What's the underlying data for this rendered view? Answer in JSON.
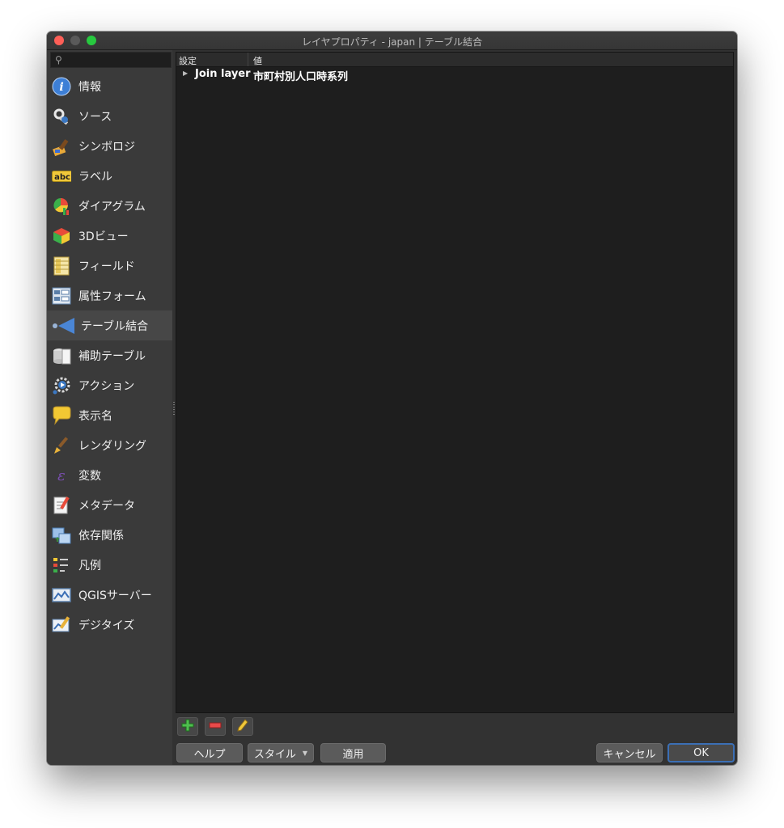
{
  "window": {
    "title": "レイヤプロパティ - japan | テーブル結合"
  },
  "search": {
    "value": "",
    "placeholder": ""
  },
  "sidebar": {
    "items": [
      {
        "label": "情報",
        "icon": "info-icon"
      },
      {
        "label": "ソース",
        "icon": "source-wrench-icon"
      },
      {
        "label": "シンボロジ",
        "icon": "paintbrush-icon"
      },
      {
        "label": "ラベル",
        "icon": "abc-label-icon"
      },
      {
        "label": "ダイアグラム",
        "icon": "diagram-icon"
      },
      {
        "label": "3Dビュー",
        "icon": "cube-3d-icon"
      },
      {
        "label": "フィールド",
        "icon": "fields-icon"
      },
      {
        "label": "属性フォーム",
        "icon": "form-icon"
      },
      {
        "label": "テーブル結合",
        "icon": "join-icon",
        "selected": true
      },
      {
        "label": "補助テーブル",
        "icon": "auxiliary-storage-icon"
      },
      {
        "label": "アクション",
        "icon": "action-gear-icon"
      },
      {
        "label": "表示名",
        "icon": "speech-bubble-icon"
      },
      {
        "label": "レンダリング",
        "icon": "rendering-brush-icon"
      },
      {
        "label": "変数",
        "icon": "variables-icon"
      },
      {
        "label": "メタデータ",
        "icon": "metadata-icon"
      },
      {
        "label": "依存関係",
        "icon": "dependencies-icon"
      },
      {
        "label": "凡例",
        "icon": "legend-icon"
      },
      {
        "label": "QGISサーバー",
        "icon": "qgis-server-icon"
      },
      {
        "label": "デジタイズ",
        "icon": "digitizing-icon"
      }
    ]
  },
  "tree": {
    "headers": {
      "setting": "設定",
      "value": "値"
    },
    "rows": [
      {
        "key": "Join layer",
        "value": "市町村別人口時系列"
      }
    ]
  },
  "toolbar": {
    "add_icon": "plus-icon",
    "remove_icon": "minus-icon",
    "edit_icon": "pencil-icon"
  },
  "buttons": {
    "help": "ヘルプ",
    "style": "スタイル",
    "apply": "適用",
    "cancel": "キャンセル",
    "ok": "OK"
  },
  "colors": {
    "close": "#fe5f57",
    "maximize": "#27c93f",
    "ok_focus": "#3b6fb5"
  }
}
